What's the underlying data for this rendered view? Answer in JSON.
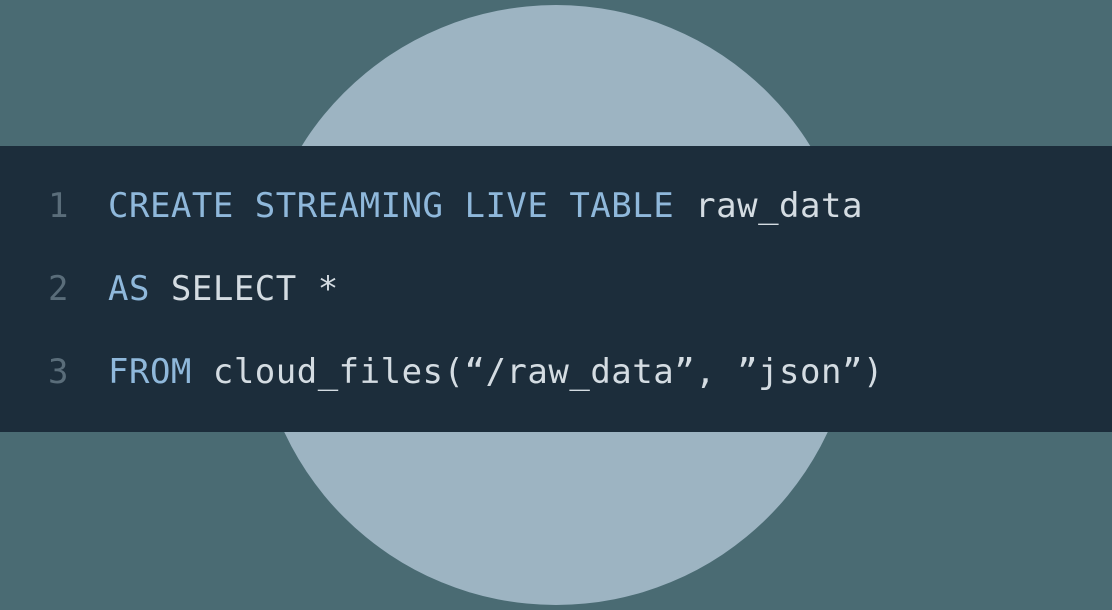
{
  "code": {
    "lines": [
      {
        "num": "1",
        "tokens": [
          {
            "t": "CREATE STREAMING LIVE TABLE",
            "k": true
          },
          {
            "t": " raw_data",
            "k": false
          }
        ]
      },
      {
        "num": "2",
        "tokens": [
          {
            "t": "AS",
            "k": true
          },
          {
            "t": " SELECT *",
            "k": false
          }
        ]
      },
      {
        "num": "3",
        "tokens": [
          {
            "t": "FROM",
            "k": true
          },
          {
            "t": " cloud_files(“/raw_data”, ”json”)",
            "k": false
          }
        ]
      }
    ]
  }
}
